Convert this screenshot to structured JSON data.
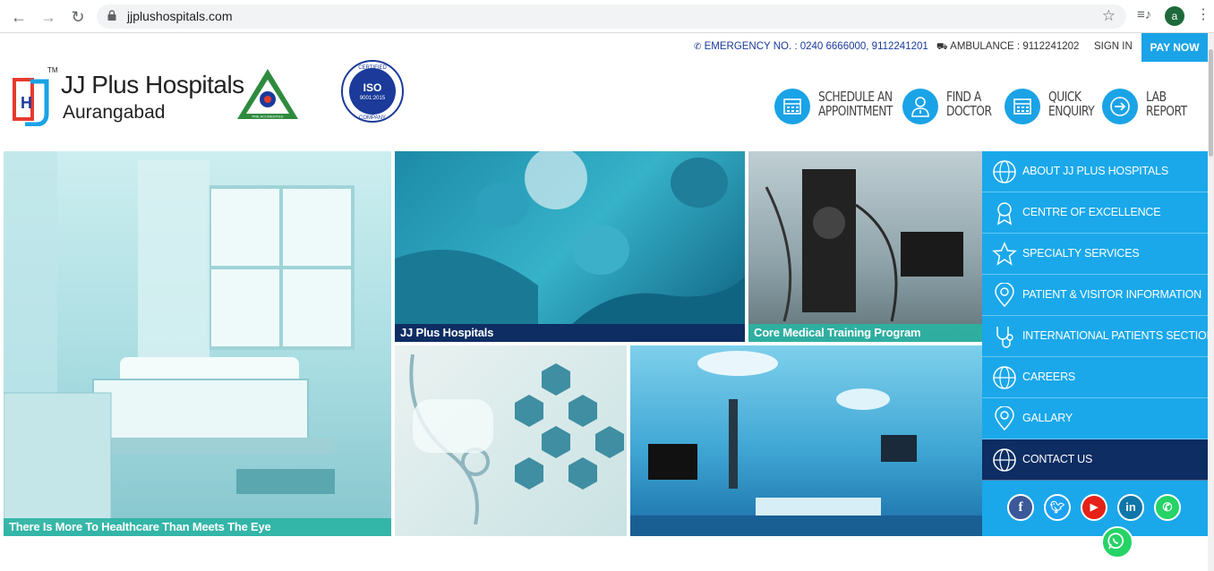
{
  "browser": {
    "url": "jjplushospitals.com",
    "profile_initial": "a"
  },
  "topbar": {
    "emergency": "EMERGENCY NO. : 0240 6666000, 9112241201",
    "ambulance": "AMBULANCE : 9112241202",
    "signin": "SIGN IN",
    "paynow": "PAY NOW"
  },
  "brand": {
    "name": "JJ Plus Hospitals",
    "city": "Aurangabad",
    "tm": "TM",
    "iso_top": "CERTIFIED",
    "iso_mid": "ISO",
    "iso_num": "9001:2015",
    "iso_bottom": "COMPANY",
    "nabh_text": "PRE ACCREDITED"
  },
  "quick_actions": [
    {
      "line1": "SCHEDULE AN",
      "line2": "APPOINTMENT",
      "icon": "calendar-icon"
    },
    {
      "line1": "FIND A",
      "line2": "DOCTOR",
      "icon": "doctor-icon"
    },
    {
      "line1": "QUICK",
      "line2": "ENQUIRY",
      "icon": "calendar-icon"
    },
    {
      "line1": "LAB",
      "line2": "REPORT",
      "icon": "arrow-right-icon"
    }
  ],
  "tiles": {
    "ward_caption": "There Is More To Healthcare Than Meets The Eye",
    "surgeons_caption": "JJ Plus Hospitals",
    "training_caption": "Core Medical Training Program"
  },
  "sidenav": [
    {
      "label": "ABOUT JJ PLUS HOSPITALS",
      "icon": "globe-icon"
    },
    {
      "label": "CENTRE OF EXCELLENCE",
      "icon": "award-icon"
    },
    {
      "label": "SPECIALTY SERVICES",
      "icon": "star-icon"
    },
    {
      "label": "PATIENT & VISITOR INFORMATION",
      "icon": "location-pin-icon"
    },
    {
      "label": "INTERNATIONAL PATIENTS SECTION",
      "icon": "stethoscope-icon"
    },
    {
      "label": "CAREERS",
      "icon": "globe-icon"
    },
    {
      "label": "GALLARY",
      "icon": "location-pin-icon"
    },
    {
      "label": "CONTACT US",
      "icon": "globe-icon"
    }
  ],
  "social": [
    "facebook-icon",
    "twitter-icon",
    "youtube-icon",
    "linkedin-icon",
    "whatsapp-icon"
  ],
  "colors": {
    "accent": "#1aa3e6",
    "nav_active": "#0d2d63",
    "caption_teal": "#2ab3a3",
    "caption_navy": "#0d2d63"
  }
}
